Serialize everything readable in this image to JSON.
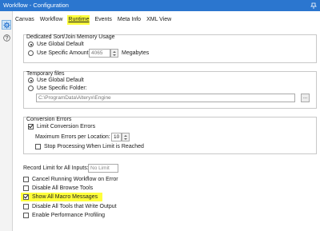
{
  "window": {
    "title": "Workflow - Configuration"
  },
  "tabs": [
    {
      "label": "Canvas"
    },
    {
      "label": "Workflow"
    },
    {
      "label": "Runtime"
    },
    {
      "label": "Events"
    },
    {
      "label": "Meta Info"
    },
    {
      "label": "XML View"
    }
  ],
  "memory": {
    "title": "Dedicated Sort/Join Memory Usage",
    "global_label": "Use Global Default",
    "specific_label": "Use Specific Amount:",
    "amount_value": "4065",
    "unit_label": "Megabytes",
    "selected": "global"
  },
  "temp": {
    "title": "Temporary files",
    "global_label": "Use Global Default",
    "specific_label": "Use Specific Folder:",
    "folder_value": "C:\\ProgramData\\Alteryx\\Engine",
    "browse_label": "...",
    "selected": "global"
  },
  "errors": {
    "title": "Conversion Errors",
    "limit_label": "Limit Conversion Errors",
    "limit_checked": true,
    "max_label": "Maximum Errors per Location:",
    "max_value": "10",
    "stop_label": "Stop Processing When Limit is Reached",
    "stop_checked": false
  },
  "record_limit": {
    "label": "Record Limit for All Inputs:",
    "placeholder": "No Limit"
  },
  "options": [
    {
      "label": "Cancel Running Workflow on Error",
      "checked": false
    },
    {
      "label": "Disable All Browse Tools",
      "checked": false
    },
    {
      "label": "Show All Macro Messages",
      "checked": true,
      "highlighted": true
    },
    {
      "label": "Disable All Tools that Write Output",
      "checked": false
    },
    {
      "label": "Enable Performance Profiling",
      "checked": false
    }
  ],
  "colors": {
    "titlebar": "#2b76cf",
    "highlight": "#ffff3c"
  }
}
